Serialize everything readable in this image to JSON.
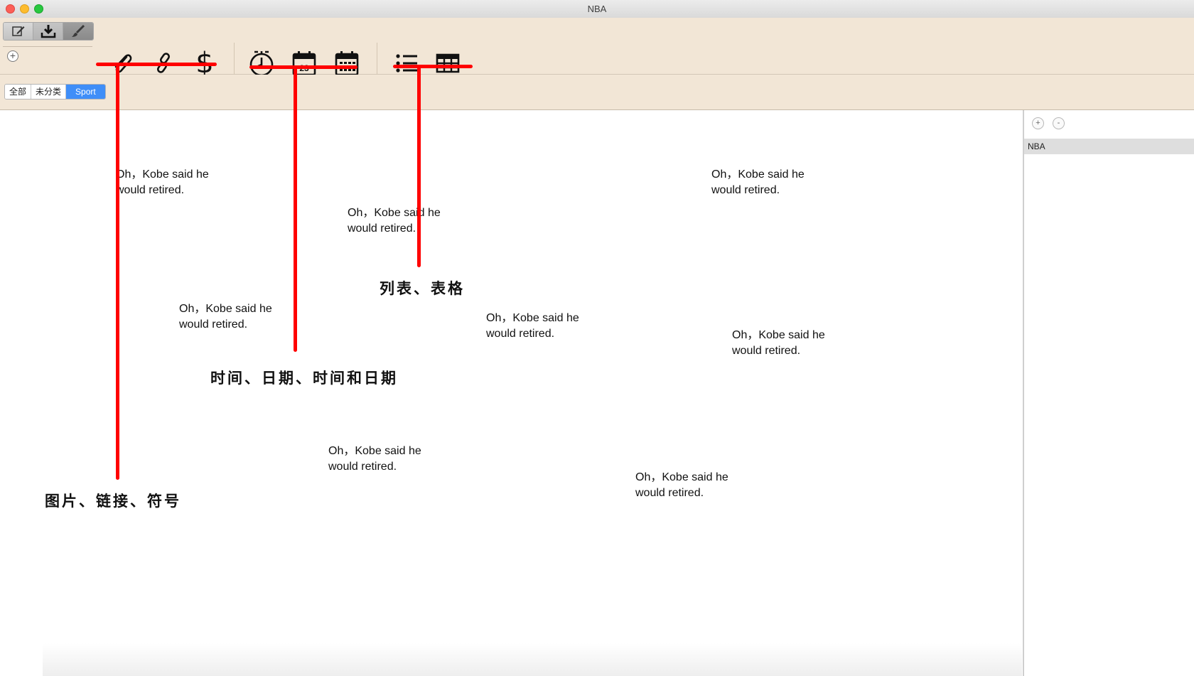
{
  "window": {
    "title": "NBA"
  },
  "toolbar": {
    "segments": [
      "edit-icon",
      "download-icon",
      "brush-icon"
    ],
    "tools": [
      "paperclip-icon",
      "link-icon",
      "dollar-icon",
      "clock-icon",
      "calendar-day-icon",
      "calendar-grid-icon",
      "list-icon",
      "table-icon"
    ],
    "calendar_day": "23",
    "dollar_symbol": "$"
  },
  "add_button": {
    "label": "+"
  },
  "filters": {
    "items": [
      "全部",
      "未分类",
      "Sport"
    ],
    "active": "Sport"
  },
  "sidebar": {
    "plus": "+",
    "minus": "-",
    "items": [
      "NBA"
    ]
  },
  "notes": [
    "Oh，Kobe said he\nwould retired.",
    "Oh，Kobe said he\nwould retired.",
    "Oh，Kobe said he\nwould retired.",
    "Oh，Kobe said he\nwould retired.",
    "Oh，Kobe said he\nwould retired.",
    "Oh，Kobe said he\nwould retired.",
    "Oh，Kobe said he\nwould retired.",
    "Oh，Kobe said he\nwould retired."
  ],
  "annotations": {
    "list_table": "列表、表格",
    "time_date": "时间、日期、时间和日期",
    "image_link_symbol": "图片、链接、符号"
  },
  "colors": {
    "toolbar_bg": "#f2e6d6",
    "accent": "#3f8ef8",
    "annotation": "#ff0000"
  }
}
